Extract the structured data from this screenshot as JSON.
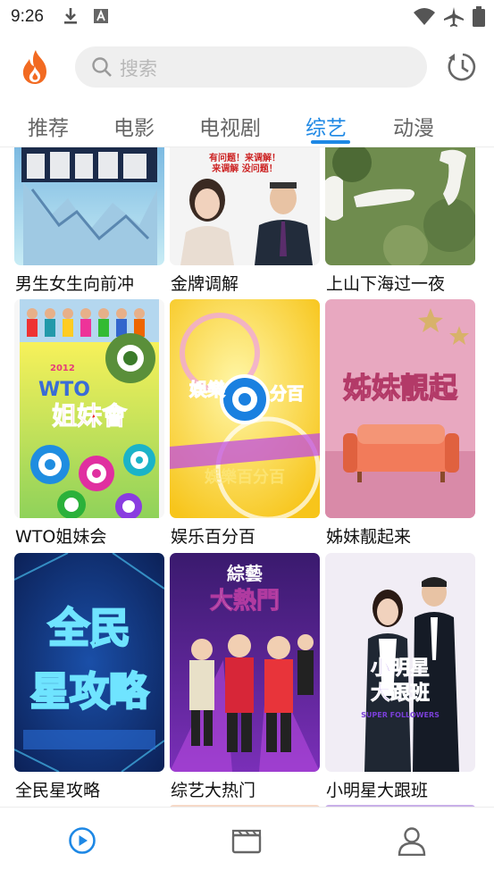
{
  "status_bar": {
    "time": "9:26",
    "icons": [
      "download-icon",
      "a-badge-icon",
      "wifi-icon",
      "airplane-icon",
      "battery-icon"
    ]
  },
  "header": {
    "logo": "flame-logo",
    "search_placeholder": "搜索",
    "history_icon": "history-clock-icon"
  },
  "tabs": [
    {
      "label": "推荐",
      "active": false
    },
    {
      "label": "电影",
      "active": false
    },
    {
      "label": "电视剧",
      "active": false
    },
    {
      "label": "综艺",
      "active": true
    },
    {
      "label": "动漫",
      "active": false
    }
  ],
  "shows": [
    {
      "title": "男生女生向前冲"
    },
    {
      "title": "金牌调解",
      "poster_text": "有问题！来调解！来调解 没问题！"
    },
    {
      "title": "上山下海过一夜"
    },
    {
      "title": "WTO姐妹会",
      "poster_text": "WTO 姐妹會",
      "poster_year": "2012"
    },
    {
      "title": "娱乐百分百",
      "poster_text": "娛樂百分百"
    },
    {
      "title": "姊妹靓起来",
      "poster_text": "姊妹靚起来"
    },
    {
      "title": "全民星攻略",
      "poster_text": "全民星攻略"
    },
    {
      "title": "综艺大热门",
      "poster_text": "綜藝大熱門"
    },
    {
      "title": "小明星大跟班",
      "poster_text": "小明星大跟班",
      "poster_subtext": "SUPER FOLLOWERS"
    }
  ],
  "bottom_nav": [
    {
      "name": "play",
      "icon": "play-circle-icon",
      "active": true
    },
    {
      "name": "clapperboard",
      "icon": "clapperboard-icon",
      "active": false
    },
    {
      "name": "profile",
      "icon": "user-icon",
      "active": false
    }
  ],
  "colors": {
    "accent": "#1e88e5",
    "logo": "#f26a21",
    "search_bg": "#efefef"
  }
}
